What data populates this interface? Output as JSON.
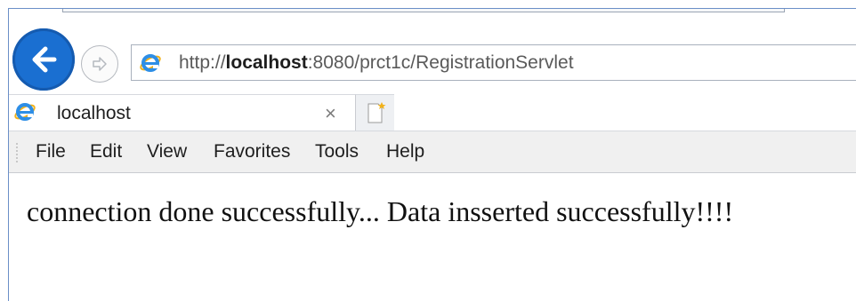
{
  "browser": {
    "url": {
      "prefix": "http://",
      "host": "localhost",
      "rest": ":8080/prct1c/RegistrationServlet"
    },
    "tab": {
      "title": "localhost",
      "close_glyph": "×"
    },
    "menu": [
      "File",
      "Edit",
      "View",
      "Favorites",
      "Tools",
      "Help"
    ],
    "icons": {
      "back": "back-arrow-icon",
      "forward": "forward-arrow-icon",
      "site": "internet-explorer-icon",
      "new_tab": "new-tab-icon"
    },
    "colors": {
      "back_button": "#1a6fd1",
      "ie_icon": "#2d8ee6",
      "new_tab_star": "#f2b21b"
    }
  },
  "page": {
    "message": "connection done successfully... Data insserted successfully!!!!"
  }
}
